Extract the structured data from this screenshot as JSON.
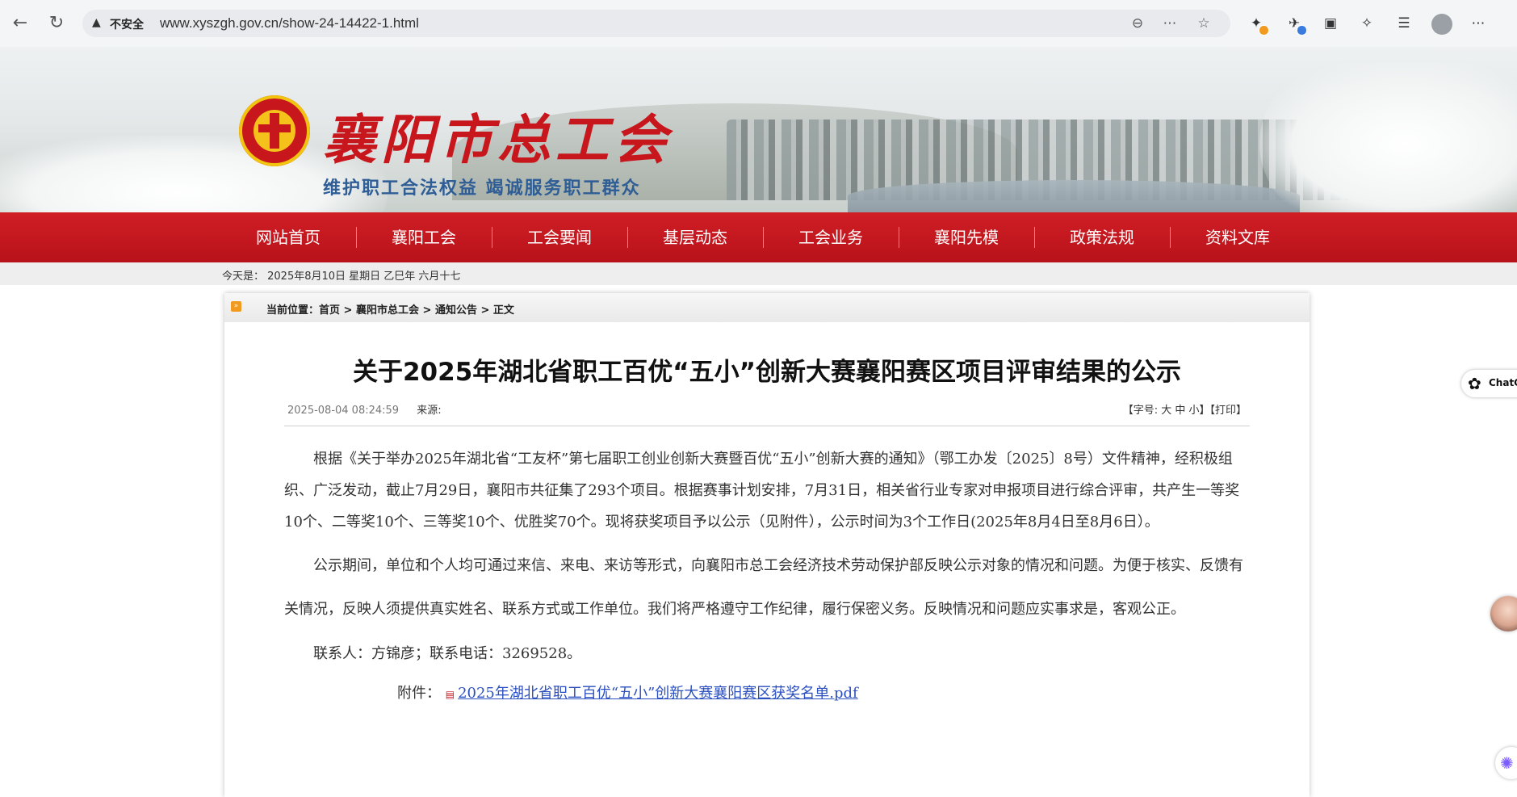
{
  "browser": {
    "security_label": "不安全",
    "url": "www.xyszgh.gov.cn/show-24-14422-1.html"
  },
  "site": {
    "name": "襄阳市总工会",
    "slogan": "维护职工合法权益  竭诚服务职工群众"
  },
  "nav": [
    {
      "label": "网站首页"
    },
    {
      "label": "襄阳工会"
    },
    {
      "label": "工会要闻"
    },
    {
      "label": "基层动态"
    },
    {
      "label": "工会业务"
    },
    {
      "label": "襄阳先模"
    },
    {
      "label": "政策法规"
    },
    {
      "label": "资料文库"
    }
  ],
  "date_bar": "今天是： 2025年8月10日 星期日 乙巳年 六月十七",
  "breadcrumb": {
    "prefix": "当前位置：",
    "items": [
      "首页",
      "襄阳市总工会",
      "通知公告",
      "正文"
    ],
    "sep": " > "
  },
  "article": {
    "title": "关于2025年湖北省职工百优“五小”创新大赛襄阳赛区项目评审结果的公示",
    "datetime": "2025-08-04 08:24:59",
    "source_label": "来源:",
    "font_size_ctrl": "【字号: 大 中 小】【打印】",
    "p1": "根据《关于举办2025年湖北省“工友杯”第七届职工创业创新大赛暨百优“五小”创新大赛的通知》（鄂工办发〔2025〕8号）文件精神，经积极组织、广泛发动，截止7月29日，襄阳市共征集了293个项目。根据赛事计划安排，7月31日，相关省行业专家对申报项目进行综合评审，共产生一等奖10个、二等奖10个、三等奖10个、优胜奖70个。现将获奖项目予以公示（见附件），公示时间为3个工作日(2025年8月4日至8月6日）。",
    "p2": "公示期间，单位和个人均可通过来信、来电、来访等形式，向襄阳市总工会经济技术劳动保护部反映公示对象的情况和问题。为便于核实、反馈有关情况，反映人须提供真实姓名、联系方式或工作单位。我们将严格遵守工作纪律，履行保密义务。反映情况和问题应实事求是，客观公正。",
    "p3": "联系人：方锦彦；联系电话：3269528。",
    "attachment_label": "附件：",
    "attachment_link": "2025年湖北省职工百优“五小”创新大赛襄阳赛区获奖名单.pdf"
  },
  "side": {
    "chat_label": "ChatG"
  }
}
